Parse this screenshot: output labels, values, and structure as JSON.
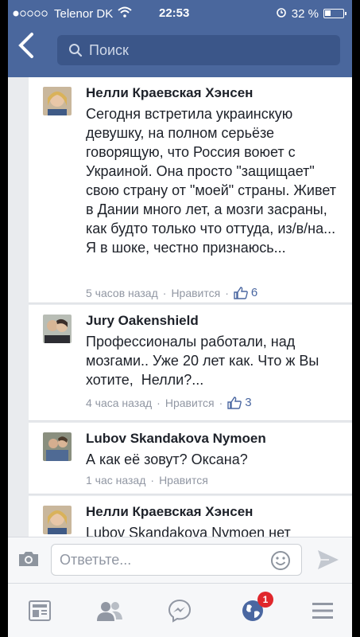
{
  "status_bar": {
    "carrier": "Telenor DK",
    "time": "22:53",
    "battery": "32 %"
  },
  "nav": {
    "search_placeholder": "Поиск"
  },
  "comments": [
    {
      "author": "Нелли Краевская Хэнсен",
      "text": "Сегодня встретила украинскую девушку, на полном серьёзе говорящую, что Россия воюет с Украиной. Она просто \"защищает\" свою страну от \"моей\" страны. Живет в Дании много лет, а мозги засраны, как будто только что оттуда, из/в/на... Я в шоке, честно признаюсь...",
      "time": "5 часов назад",
      "like_label": "Нравится",
      "likes": "6"
    },
    {
      "author": "Jury Oakenshield",
      "text": "Профессионалы работали, над мозгами.. Уже 20 лет как. Что ж Вы хотите,  Нелли?...",
      "time": "4 часа назад",
      "like_label": "Нравится",
      "likes": "3"
    },
    {
      "author": "Lubov Skandakova Nymoen",
      "text": "А как её зовут? Оксана?",
      "time": "1 час назад",
      "like_label": "Нравится",
      "likes": ""
    },
    {
      "author": "Нелли Краевская Хэнсен",
      "text": "Lubov Skandakova Nymoen нет"
    }
  ],
  "reply": {
    "placeholder": "Ответьте..."
  },
  "tabbar": {
    "notifications_count": "1"
  },
  "colors": {
    "header": "#4a679d",
    "accent": "#4a67a1",
    "badge": "#e0272c"
  }
}
